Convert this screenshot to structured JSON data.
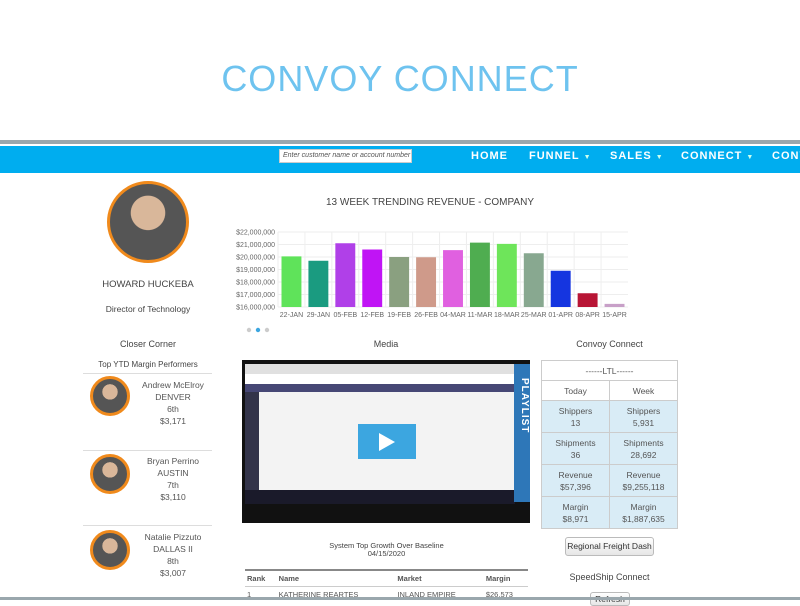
{
  "app_title": "CONVOY CONNECT",
  "nav": {
    "search_placeholder": "Enter customer name or account number",
    "items": [
      {
        "label": "HOME",
        "dropdown": false
      },
      {
        "label": "FUNNEL",
        "dropdown": true
      },
      {
        "label": "SALES",
        "dropdown": true
      },
      {
        "label": "CONNECT",
        "dropdown": true
      },
      {
        "label": "CONV",
        "dropdown": false
      }
    ],
    "color": "#00adef"
  },
  "profile": {
    "name": "HOWARD HUCKEBA",
    "role": "Director of Technology"
  },
  "closer_corner": {
    "title": "Closer Corner",
    "subtitle": "Top YTD Margin Performers",
    "performers": [
      {
        "name": "Andrew McElroy",
        "market": "DENVER",
        "rank": "6th",
        "margin": "$3,171"
      },
      {
        "name": "Bryan Perrino",
        "market": "AUSTIN",
        "rank": "7th",
        "margin": "$3,110"
      },
      {
        "name": "Natalie Pizzuto",
        "market": "DALLAS II",
        "rank": "8th",
        "margin": "$3,007"
      }
    ]
  },
  "chart_data": {
    "type": "bar",
    "title": "13 WEEK TRENDING REVENUE - COMPANY",
    "categories": [
      "22-JAN",
      "29-JAN",
      "05-FEB",
      "12-FEB",
      "19-FEB",
      "26-FEB",
      "04-MAR",
      "11-MAR",
      "18-MAR",
      "25-MAR",
      "01-APR",
      "08-APR",
      "15-APR"
    ],
    "values": [
      20050000,
      19700000,
      21100000,
      20600000,
      20000000,
      19980000,
      20550000,
      21150000,
      21050000,
      20300000,
      18900000,
      17100000,
      16250000
    ],
    "colors": [
      "#5fe35a",
      "#1a9b80",
      "#b040e8",
      "#c014f5",
      "#8aa080",
      "#cf9a8a",
      "#e060e0",
      "#4fad50",
      "#6ee55a",
      "#88a890",
      "#1535e0",
      "#b81535",
      "#c8a0c8"
    ],
    "ylim": [
      16000000,
      22000000
    ],
    "yticks": [
      "$22,000,000",
      "$21,000,000",
      "$20,000,000",
      "$19,000,000",
      "$18,000,000",
      "$17,000,000",
      "$16,000,000"
    ],
    "grid": true
  },
  "media": {
    "title": "Media",
    "playlist_label": "PLAYLIST"
  },
  "convoy": {
    "title": "Convoy Connect",
    "header": "------LTL------",
    "col_today": "Today",
    "col_week": "Week",
    "rows": [
      {
        "label": "Shippers",
        "today": "13",
        "week": "5,931"
      },
      {
        "label": "Shipments",
        "today": "36",
        "week": "28,692"
      },
      {
        "label": "Revenue",
        "today": "$57,396",
        "week": "$9,255,118"
      },
      {
        "label": "Margin",
        "today": "$8,971",
        "week": "$1,887,635"
      }
    ],
    "button": "Regional Freight Dash"
  },
  "speedship": {
    "title": "SpeedShip Connect",
    "button": "Refresh"
  },
  "growth": {
    "title": "System Top Growth Over Baseline",
    "date": "04/15/2020",
    "headers": [
      "Rank",
      "Name",
      "Market",
      "Margin"
    ],
    "rows": [
      [
        "1",
        "KATHERINE REARTES",
        "INLAND EMPIRE",
        "$26,573"
      ]
    ]
  }
}
